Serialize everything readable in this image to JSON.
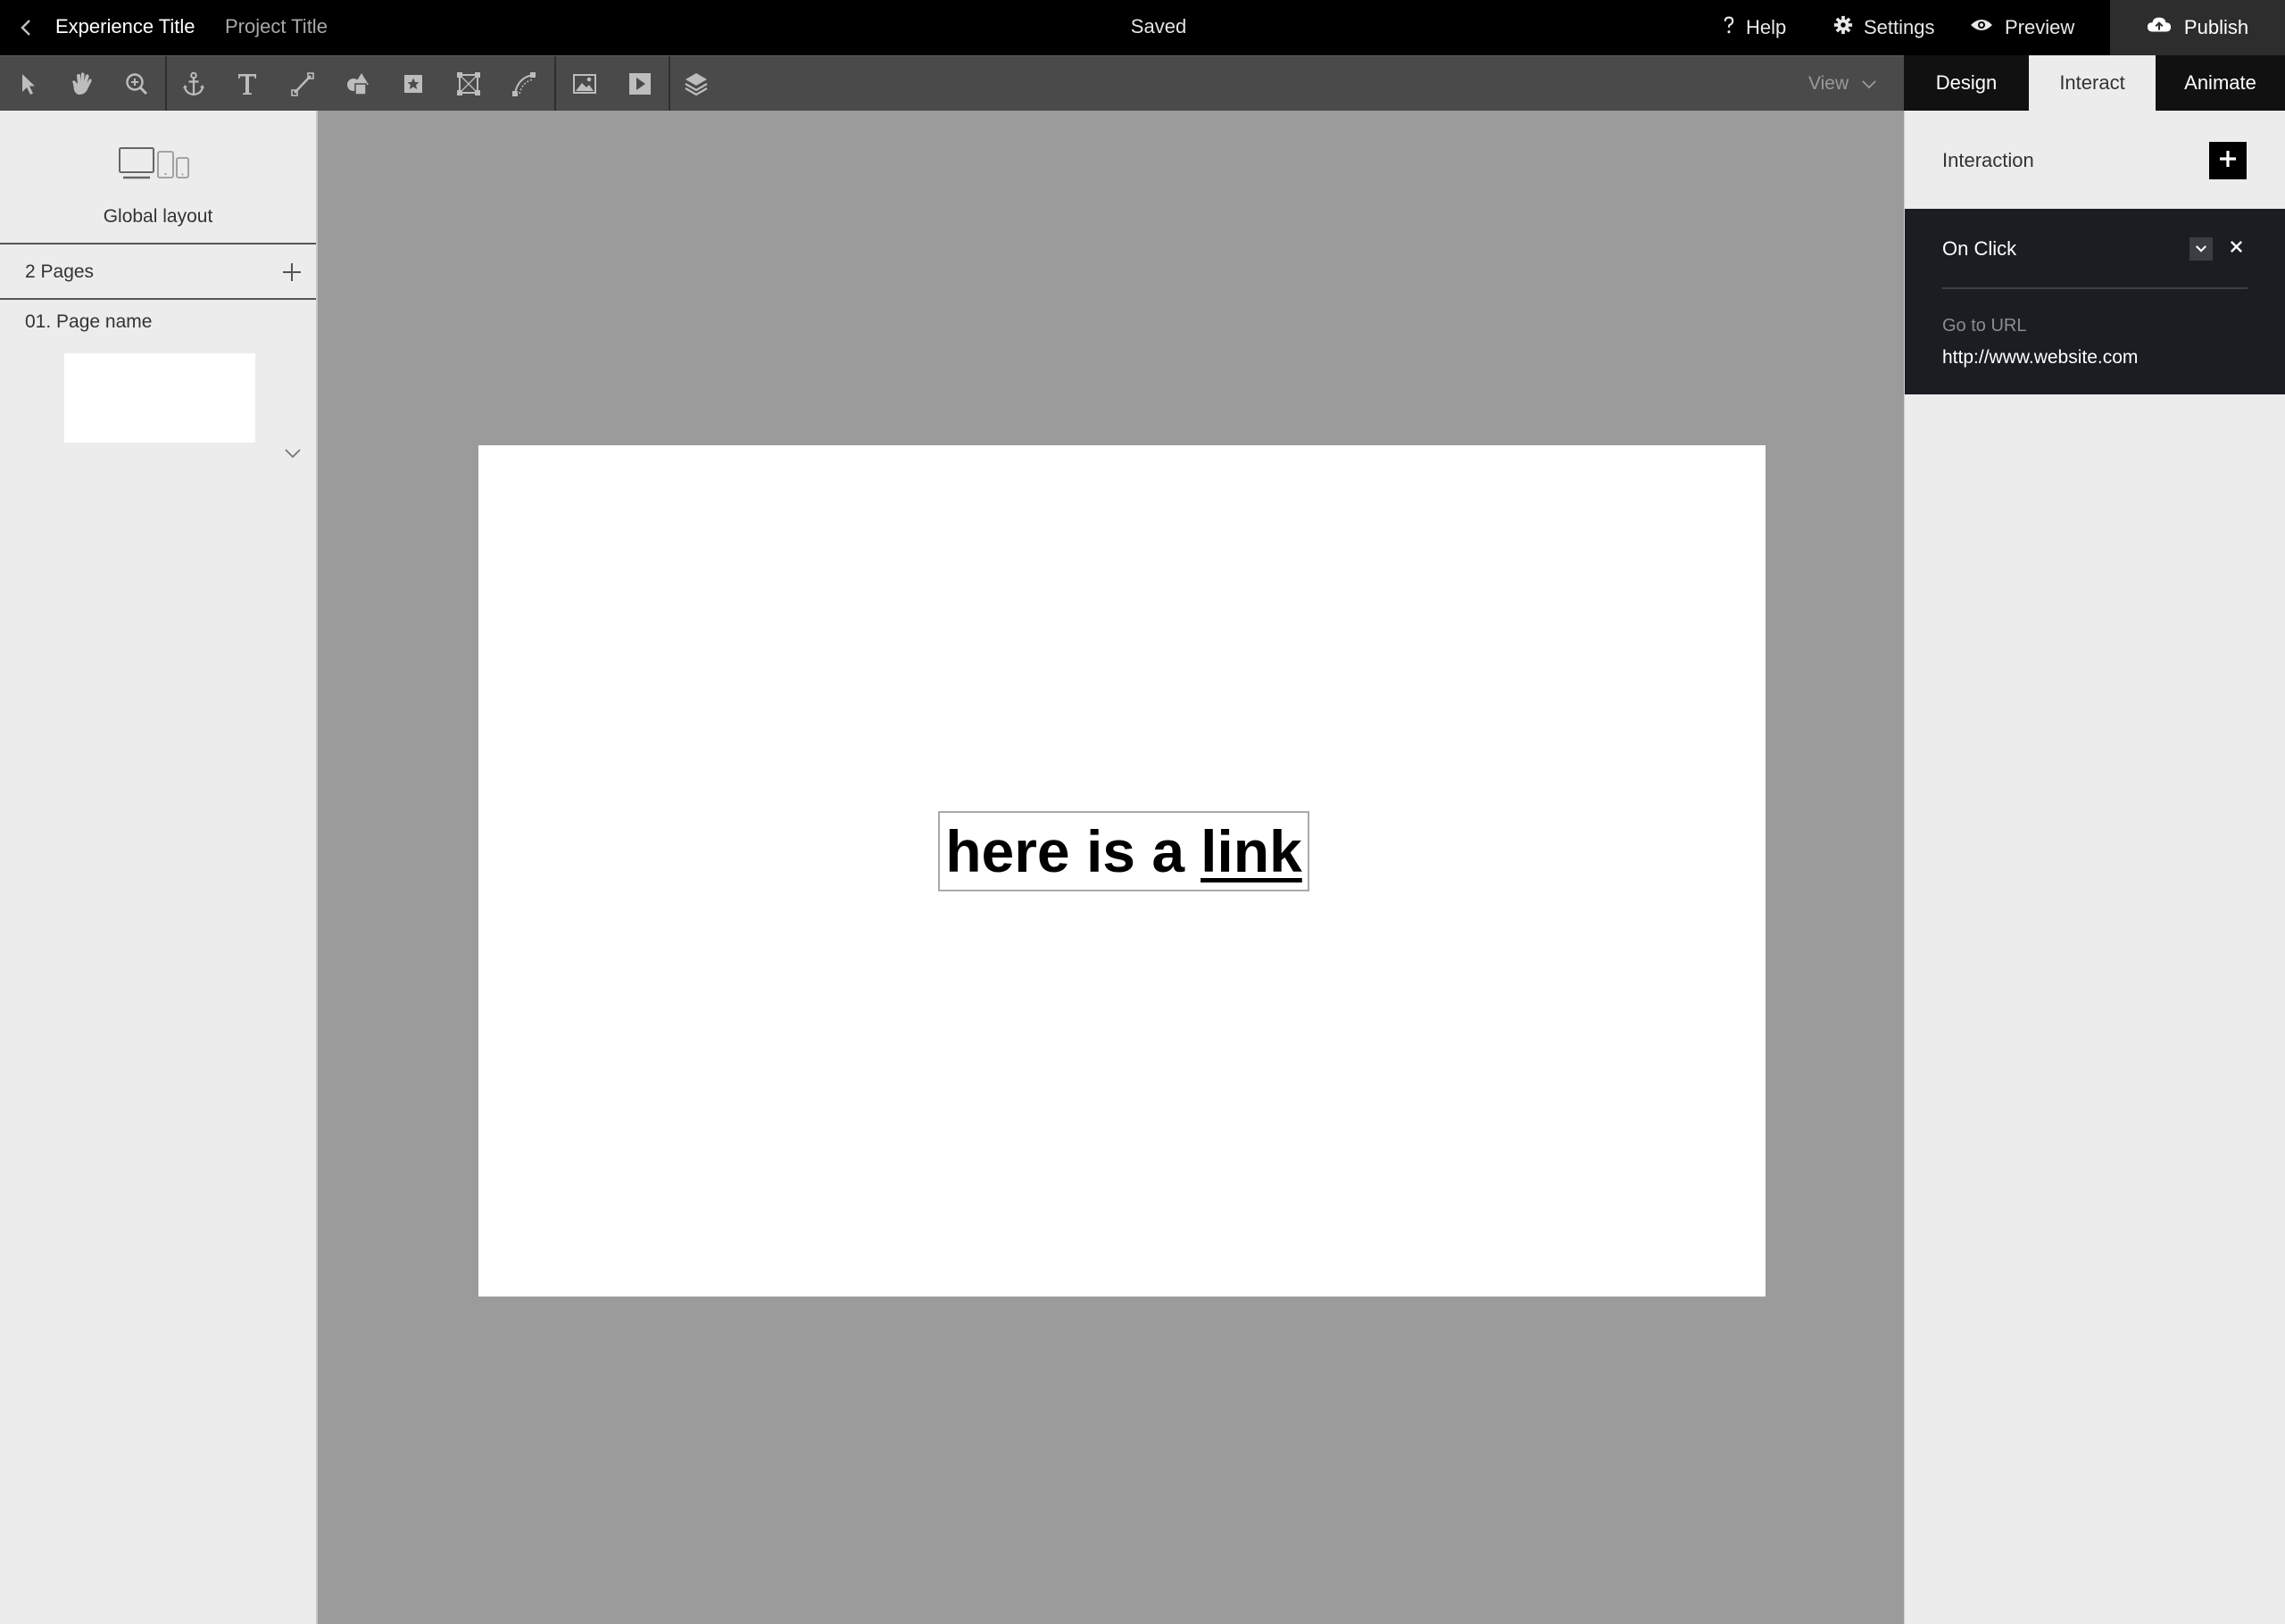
{
  "topbar": {
    "experience_title": "Experience Title",
    "project_title": "Project Title",
    "status": "Saved",
    "help_label": "Help",
    "settings_label": "Settings",
    "preview_label": "Preview",
    "publish_label": "Publish"
  },
  "toolbar": {
    "tools": [
      "select-arrow-icon",
      "hand-icon",
      "zoom-icon",
      "anchor-icon",
      "text-icon",
      "line-icon",
      "shapes-icon",
      "symbol-icon",
      "frame-icon",
      "path-icon",
      "image-icon",
      "video-icon",
      "layers-icon"
    ],
    "view_label": "View"
  },
  "right_panel": {
    "tabs": [
      {
        "label": "Design",
        "active": false
      },
      {
        "label": "Interact",
        "active": true
      },
      {
        "label": "Animate",
        "active": false
      }
    ],
    "interaction_label": "Interaction",
    "trigger_label": "On Click",
    "action_label": "Go to URL",
    "action_value": "http://www.website.com"
  },
  "sidebar": {
    "global_layout_label": "Global layout",
    "pages_count_label": "2 Pages",
    "pages": [
      {
        "name": "01. Page name"
      }
    ]
  },
  "canvas": {
    "text_element": {
      "plain_text": "here is a",
      "link_text": "link"
    }
  },
  "colors": {
    "topbar_bg": "#000000",
    "toolbar_bg": "#4a4a4a",
    "canvas_bg": "#9b9b9b",
    "panel_bg": "#ececec",
    "interaction_box_bg": "#1a1d22"
  }
}
